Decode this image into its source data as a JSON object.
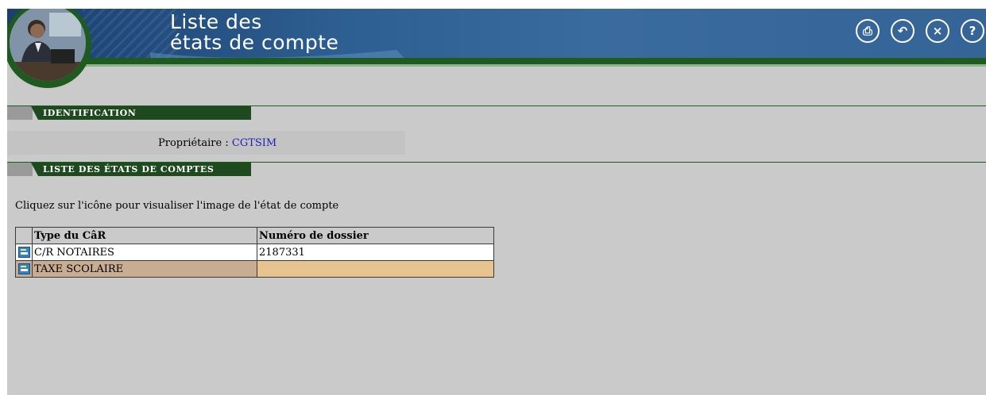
{
  "header": {
    "title_line1": "Liste des",
    "title_line2": "états de compte",
    "toolbar": [
      {
        "icon": "print-icon",
        "glyph": "⎙"
      },
      {
        "icon": "back-icon",
        "glyph": "↶"
      },
      {
        "icon": "close-icon",
        "glyph": "×"
      },
      {
        "icon": "help-icon",
        "glyph": "?"
      }
    ]
  },
  "identification": {
    "section_label": "IDENTIFICATION",
    "owner_label": "Propriétaire :",
    "owner_value": "CGTSIM"
  },
  "statements": {
    "section_label": "LISTE DES ÉTATS DE COMPTES",
    "instruction": "Cliquez sur l'icône pour visualiser l'image de l'état de compte",
    "columns": [
      "Type du CâR",
      "Numéro de dossier"
    ],
    "rows": [
      {
        "type": "C/R NOTAIRES",
        "dossier": "2187331"
      },
      {
        "type": "TAXE SCOLAIRE",
        "dossier": ""
      }
    ]
  },
  "colors": {
    "banner": "#2e5f93",
    "green": "#1f5a1f",
    "background": "#cacaca",
    "row_tan": "#c8ad92",
    "row_orange": "#e8c390"
  }
}
